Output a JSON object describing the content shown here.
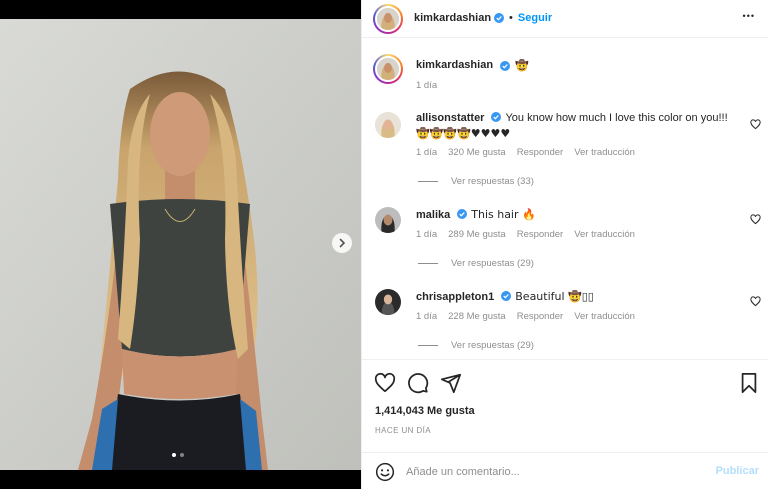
{
  "post": {
    "author": "kimkardashian",
    "follow_label": "Seguir",
    "separator": "•",
    "caption_emoji": "🤠",
    "caption_time": "1 día",
    "more_options_label": "•••"
  },
  "comments": [
    {
      "username": "allisonstatter",
      "text": "You know how much I love this color on you!!!",
      "emoji_line": "🤠🤠🤠🤠♥♥♥♥",
      "time": "1 día",
      "likes": "320 Me gusta",
      "reply_label": "Responder",
      "translate_label": "Ver traducción",
      "view_replies": "Ver respuestas (33)"
    },
    {
      "username": "malika",
      "text": "This hair 🔥",
      "time": "1 día",
      "likes": "289 Me gusta",
      "reply_label": "Responder",
      "translate_label": "Ver traducción",
      "view_replies": "Ver respuestas (29)"
    },
    {
      "username": "chrisappleton1",
      "text": "Beautiful 🤠▯▯",
      "time": "1 día",
      "likes": "228 Me gusta",
      "reply_label": "Responder",
      "translate_label": "Ver traducción",
      "view_replies": "Ver respuestas (29)"
    }
  ],
  "engagement": {
    "likes": "1,414,043 Me gusta",
    "time_ago": "Hace un día"
  },
  "composer": {
    "placeholder": "Añade un comentario...",
    "publish_label": "Publicar"
  },
  "carousel": {
    "slide_count": 2,
    "current_slide": 1
  },
  "icons": {
    "verified": "verified-badge-icon",
    "like": "heart-icon",
    "comment": "comment-icon",
    "share": "share-icon",
    "save": "bookmark-icon",
    "emoji": "emoji-icon",
    "next": "chevron-right-icon",
    "more": "more-options-icon"
  },
  "colors": {
    "accent": "#0095f6",
    "publish_disabled": "#b2dffc",
    "muted": "#8e8e8e",
    "verified": "#3897f0"
  }
}
